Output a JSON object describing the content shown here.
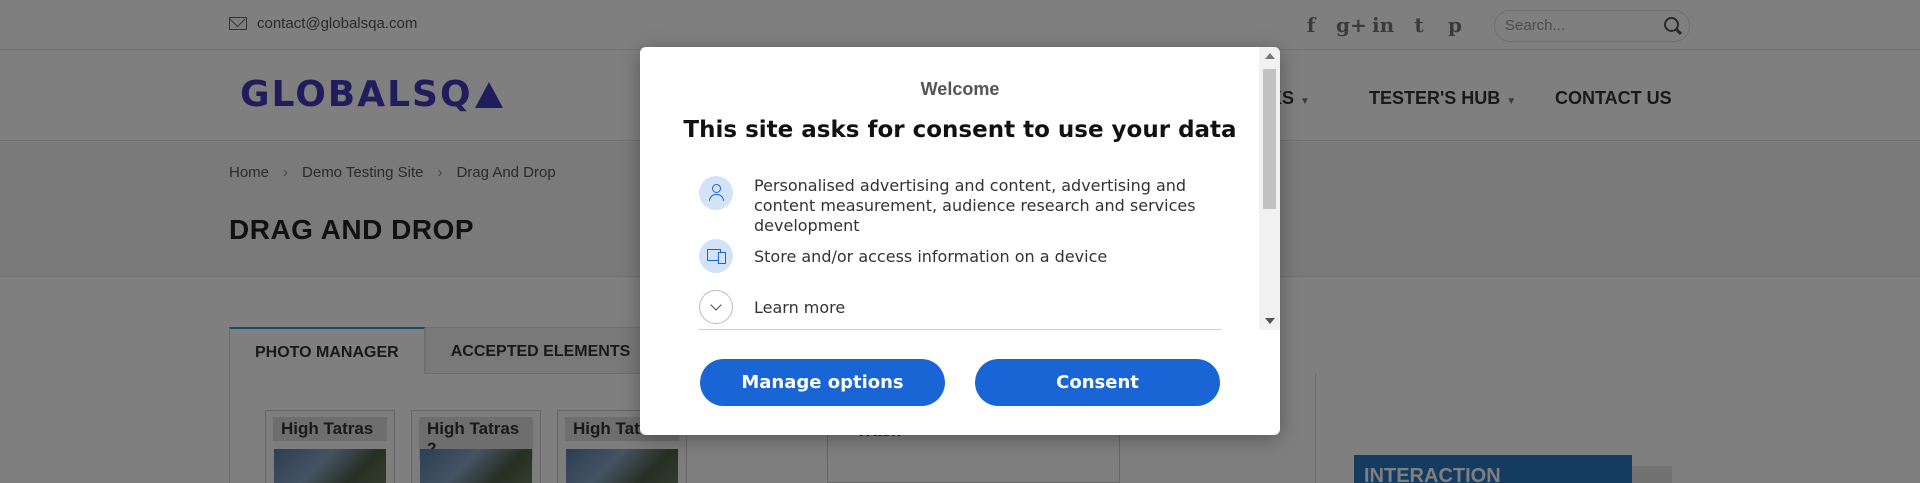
{
  "topbar": {
    "email": "contact@globalsqa.com",
    "socials": [
      {
        "name": "facebook-icon",
        "glyph": "f"
      },
      {
        "name": "google-plus-icon",
        "glyph": "g+"
      },
      {
        "name": "linkedin-icon",
        "glyph": "in"
      },
      {
        "name": "twitter-icon",
        "glyph": "t"
      },
      {
        "name": "pinterest-icon",
        "glyph": "p"
      }
    ],
    "search_placeholder": "Search..."
  },
  "header": {
    "logo": "GLOBALSQ",
    "nav": [
      "OKS",
      "TESTER'S HUB",
      "CONTACT US"
    ]
  },
  "breadcrumb": [
    "Home",
    "Demo Testing Site",
    "Drag And Drop"
  ],
  "page_title": "DRAG AND DROP",
  "tabs": [
    "PHOTO MANAGER",
    "ACCEPTED ELEMENTS"
  ],
  "photos": [
    "High Tatras",
    "High Tatras 2",
    "High Tat"
  ],
  "trash_label": "Trash",
  "side_label": "INTERACTION",
  "dialog": {
    "welcome": "Welcome",
    "title": "This site asks for consent to use your data",
    "purposes": [
      "Personalised advertising and content, advertising and content measurement, audience research and services development",
      "Store and/or access information on a device",
      "Learn more"
    ],
    "manage_label": "Manage options",
    "consent_label": "Consent"
  },
  "colors": {
    "brand": "#4338b8",
    "primary_button": "#1a65d6",
    "tab_accent": "#2aa3c9"
  }
}
